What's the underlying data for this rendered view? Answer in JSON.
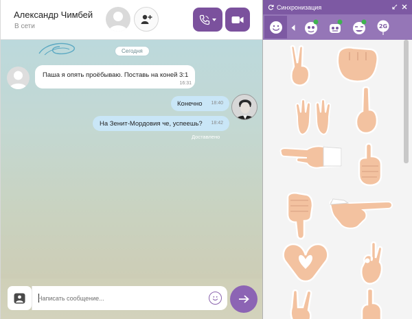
{
  "contact": {
    "name": "Александр Чимбей",
    "status": "В сети"
  },
  "chat": {
    "date_separator": "Сегодня",
    "messages": [
      {
        "direction": "incoming",
        "text": "Паша я опять проёбываю. Поставь на коней 3:1",
        "time": "16:31"
      },
      {
        "direction": "outgoing",
        "text": "Конечно",
        "time": "18:40"
      },
      {
        "direction": "outgoing",
        "text": "На Зенит-Мордовия че, успеешь?",
        "time": "18:42"
      }
    ],
    "delivery_status": "Доставлено"
  },
  "composer": {
    "placeholder": "Написать сообщение..."
  },
  "sticker_panel": {
    "title": "Синхронизация",
    "pack_tab_icons": [
      "smiley-icon",
      "pack-monster-icon",
      "pack-robot-icon",
      "pack-face-icon",
      "pack-balloon-icon"
    ],
    "pack_badge_text": "2G",
    "stickers": [
      "victory-hand",
      "fist",
      "clapping-hands",
      "middle-finger",
      "pointing-hand-left",
      "thumbs-up",
      "thumbs-down",
      "pointing-hand-right",
      "heart-hands",
      "ok-hand",
      "rock-hand",
      "raised-finger"
    ]
  },
  "colors": {
    "brand_purple": "#7b519d",
    "outgoing_bubble": "#c9e6f7",
    "incoming_bubble": "#ffffff",
    "skin": "#f3c2a0"
  }
}
